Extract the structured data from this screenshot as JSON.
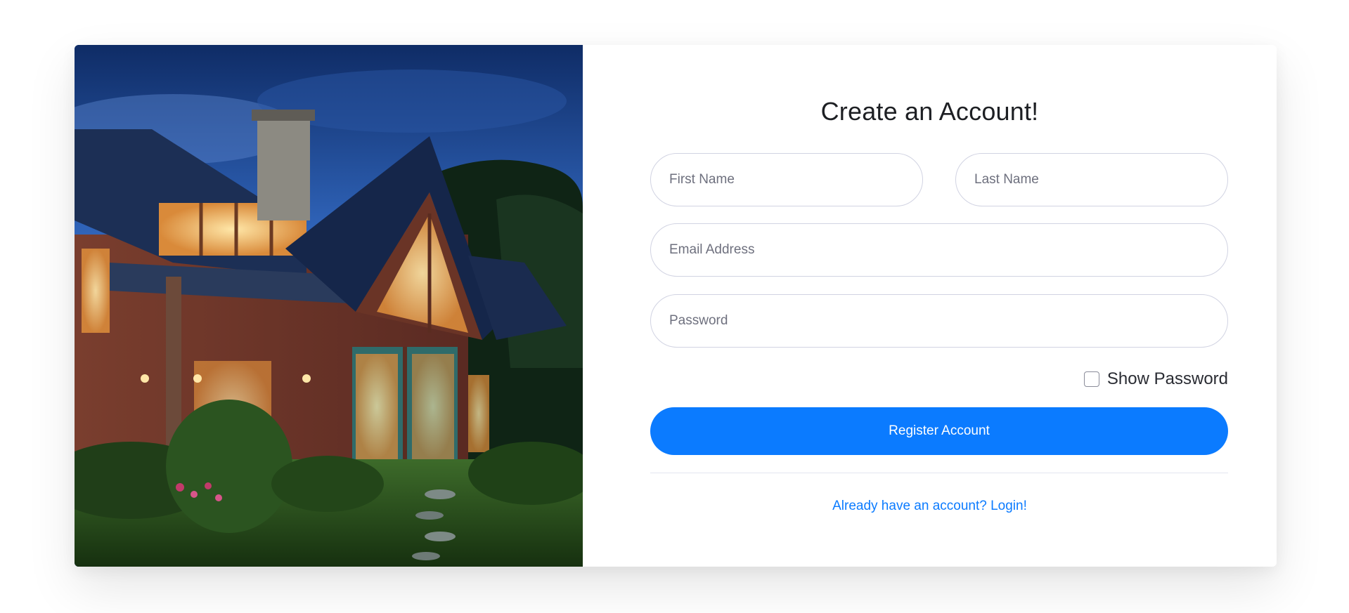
{
  "form": {
    "title": "Create an Account!",
    "first_name_placeholder": "First Name",
    "last_name_placeholder": "Last Name",
    "email_placeholder": "Email Address",
    "password_placeholder": "Password",
    "show_password_label": "Show Password",
    "show_password_checked": false,
    "register_label": "Register Account",
    "login_link_text": "Already have an account? Login!"
  },
  "colors": {
    "primary": "#0b7bff",
    "input_border": "#d1d3e2",
    "placeholder": "#6e707e",
    "title": "#1d1f23"
  },
  "image": {
    "icon": "house-photo"
  }
}
